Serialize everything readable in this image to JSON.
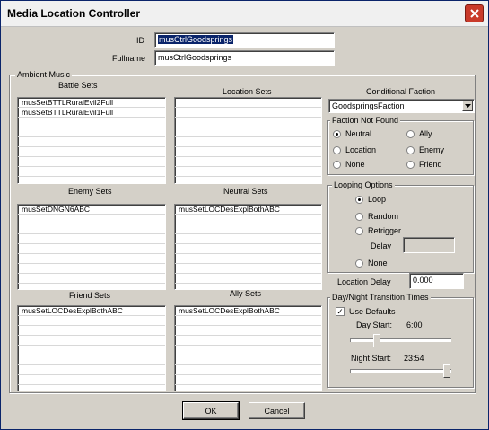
{
  "window": {
    "title": "Media Location Controller"
  },
  "id_label": "ID",
  "id_value": "musCtrlGoodsprings",
  "fullname_label": "Fullname",
  "fullname_value": "musCtrlGoodsprings",
  "ambient_music_label": "Ambient Music",
  "battle_sets": {
    "label": "Battle Sets",
    "items": [
      "musSetBTTLRuralEvil2Full",
      "musSetBTTLRuralEvil1Full"
    ]
  },
  "location_sets": {
    "label": "Location Sets",
    "items": []
  },
  "enemy_sets": {
    "label": "Enemy Sets",
    "items": [
      "musSetDNGN6ABC"
    ]
  },
  "neutral_sets": {
    "label": "Neutral Sets",
    "items": [
      "musSetLOCDesExplBothABC"
    ]
  },
  "friend_sets": {
    "label": "Friend Sets",
    "items": [
      "musSetLOCDesExplBothABC"
    ]
  },
  "ally_sets": {
    "label": "Ally Sets",
    "items": [
      "musSetLOCDesExplBothABC"
    ]
  },
  "conditional_faction": {
    "label": "Conditional Faction",
    "value": "GoodspringsFaction"
  },
  "faction_not_found": {
    "label": "Faction Not Found",
    "options": {
      "neutral": "Neutral",
      "ally": "Ally",
      "location": "Location",
      "enemy": "Enemy",
      "none": "None",
      "friend": "Friend"
    },
    "selected": "Neutral"
  },
  "looping_options": {
    "label": "Looping Options",
    "options": {
      "loop": "Loop",
      "random": "Random",
      "retrigger": "Retrigger",
      "none": "None"
    },
    "selected": "Loop",
    "delay_label": "Delay",
    "delay_value": ""
  },
  "location_delay": {
    "label": "Location Delay",
    "value": "0.000"
  },
  "day_night": {
    "label": "Day/Night Transition Times",
    "use_defaults_label": "Use Defaults",
    "use_defaults": true,
    "day_start_label": "Day Start:",
    "day_start_value": "6:00",
    "day_slider": 0.25,
    "night_start_label": "Night Start:",
    "night_start_value": "23:54",
    "night_slider": 0.996
  },
  "buttons": {
    "ok": "OK",
    "cancel": "Cancel"
  },
  "icons": {
    "close": "close-icon",
    "dropdown": "chevron-down-icon"
  },
  "colors": {
    "titlebar_close": "#c93a2a",
    "selection": "#0a246a",
    "window_bg": "#d4d0c8"
  }
}
